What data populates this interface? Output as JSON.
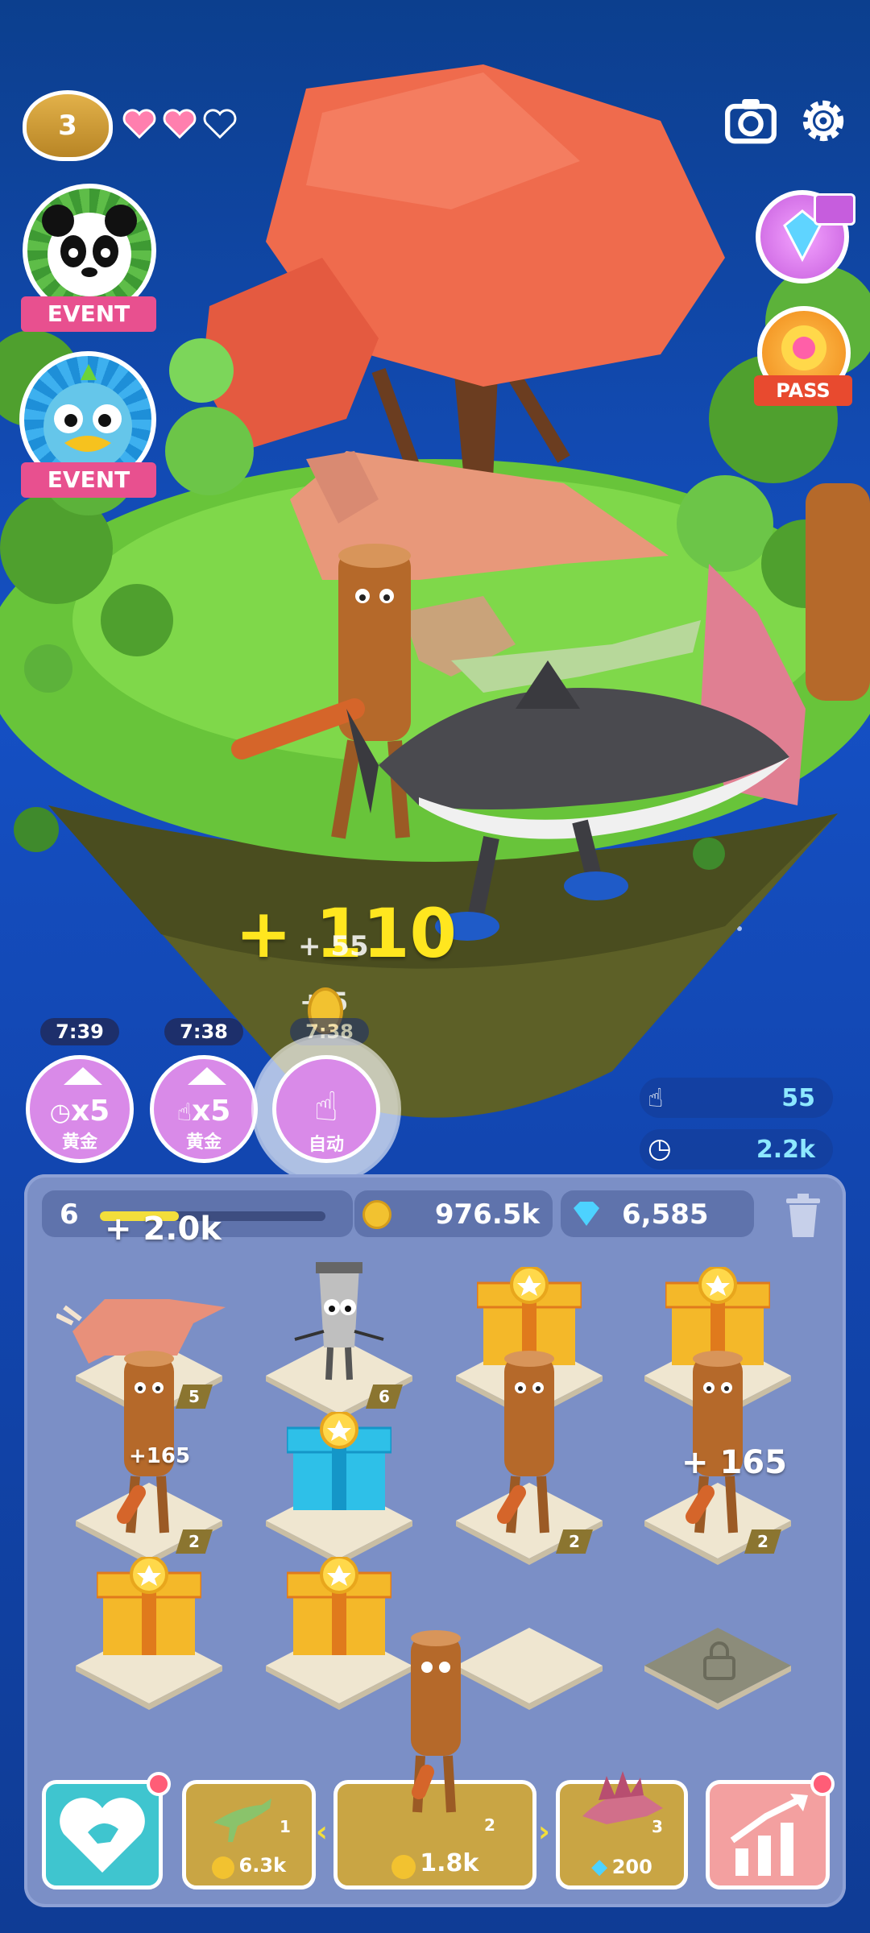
{
  "hud": {
    "level": "3",
    "hearts_full": 2,
    "hearts_total": 3
  },
  "events": {
    "event1_label": "EVENT",
    "event2_label": "EVENT",
    "pass_label": "PASS"
  },
  "scene": {
    "floating_gain": "+ 110",
    "floating_small1": "+ 55",
    "floating_small2": "+ 5"
  },
  "boosts": [
    {
      "timer": "7:39",
      "multiplier": "x5",
      "label": "黄金"
    },
    {
      "timer": "7:38",
      "multiplier": "x5",
      "label": "黄金"
    },
    {
      "timer": "7:38",
      "multiplier": "",
      "label": "自动"
    }
  ],
  "stats": {
    "tap_rate": "55",
    "idle_rate": "2.2k"
  },
  "panel": {
    "level": "6",
    "level_progress": 0.35,
    "coins": "976.5k",
    "gems": "6,585"
  },
  "grid": [
    {
      "type": "triceratops",
      "level": "5",
      "popup": "+ 2.0k"
    },
    {
      "type": "cup-ninja",
      "level": "6"
    },
    {
      "type": "gift-gold"
    },
    {
      "type": "gift-gold"
    },
    {
      "type": "log-man",
      "level": "2",
      "popup": "+165"
    },
    {
      "type": "gift-blue"
    },
    {
      "type": "log-man",
      "level": "2"
    },
    {
      "type": "log-man",
      "level": "2",
      "popup": "+ 165"
    },
    {
      "type": "gift-gold"
    },
    {
      "type": "gift-gold"
    },
    {
      "type": "empty"
    },
    {
      "type": "locked"
    }
  ],
  "shop": [
    {
      "level": "1",
      "price": "6.3k",
      "currency": "coin"
    },
    {
      "level": "2",
      "price": "1.8k",
      "currency": "coin"
    },
    {
      "level": "3",
      "price": "200",
      "currency": "gem"
    }
  ],
  "colors": {
    "sky": "#1550c4",
    "panel": "#7b8fc6",
    "boost": "#d98ae8",
    "gold": "#c9a544",
    "accent_pink": "#e8508f",
    "stat_text": "#8de8ff"
  }
}
